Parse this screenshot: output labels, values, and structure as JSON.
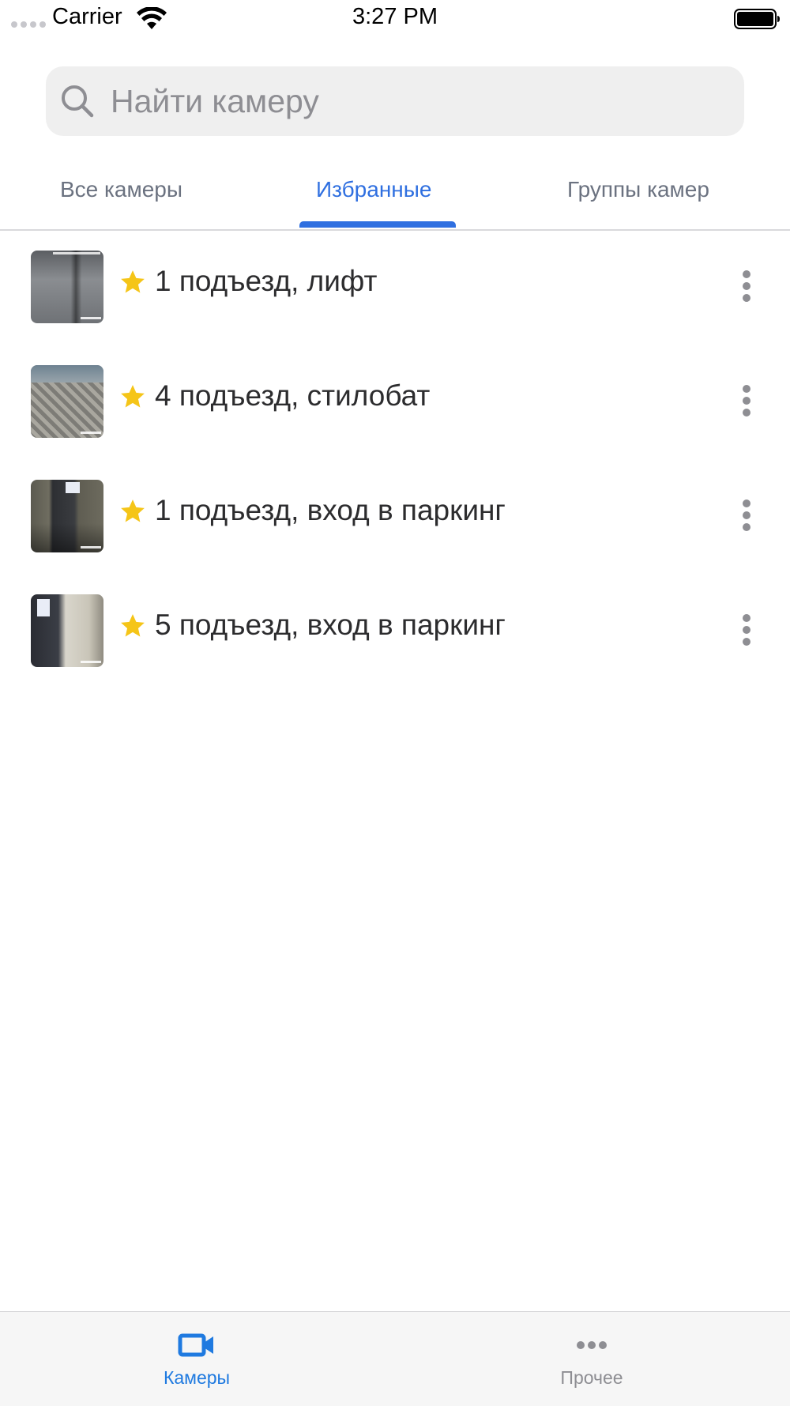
{
  "status_bar": {
    "carrier": "Carrier",
    "time": "3:27 PM",
    "icons": [
      "signal-dots-icon",
      "wifi-icon",
      "battery-icon"
    ]
  },
  "search": {
    "placeholder": "Найти камеру",
    "icon": "search-icon"
  },
  "tabs": [
    {
      "label": "Все камеры",
      "active": false
    },
    {
      "label": "Избранные",
      "active": true
    },
    {
      "label": "Группы камер",
      "active": false
    }
  ],
  "cameras": [
    {
      "name": "1 подъезд, лифт",
      "favorite": true,
      "icon": "star-icon",
      "menu_icon": "more-vertical-icon"
    },
    {
      "name": "4 подъезд, стилобат",
      "favorite": true,
      "icon": "star-icon",
      "menu_icon": "more-vertical-icon"
    },
    {
      "name": "1 подъезд, вход в паркинг",
      "favorite": true,
      "icon": "star-icon",
      "menu_icon": "more-vertical-icon"
    },
    {
      "name": "5 подъезд, вход в паркинг",
      "favorite": true,
      "icon": "star-icon",
      "menu_icon": "more-vertical-icon"
    }
  ],
  "tabbar": [
    {
      "label": "Камеры",
      "icon": "video-camera-icon",
      "active": true
    },
    {
      "label": "Прочее",
      "icon": "more-horizontal-icon",
      "active": false
    }
  ],
  "colors": {
    "accent": "#2f6fe0",
    "tabbar_active": "#1f7ae0",
    "star": "#f5c518",
    "inactive": "#8e8e93"
  }
}
